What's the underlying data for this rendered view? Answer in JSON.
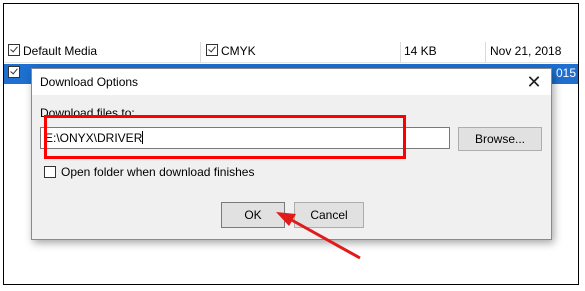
{
  "list": {
    "row1": {
      "col1": "Default Media",
      "col2": "CMYK",
      "col3": "14 KB",
      "col4": "Nov 21, 2018"
    },
    "row2": {
      "col4_fragment": "015"
    }
  },
  "dialog": {
    "title": "Download Options",
    "close_glyph": "✕",
    "download_label": "Download files to:",
    "path_value": "E:\\ONYX\\DRIVER",
    "browse_label": "Browse...",
    "open_folder_label": "Open folder when download finishes",
    "ok_label": "OK",
    "cancel_label": "Cancel"
  },
  "annotations": {
    "highlight_color": "#ff0000",
    "arrow_color": "#e11a1a"
  },
  "colors": {
    "selection": "#1e6fd0",
    "dialog_bg": "#f0f0f0",
    "button_bg": "#e1e1e1"
  }
}
